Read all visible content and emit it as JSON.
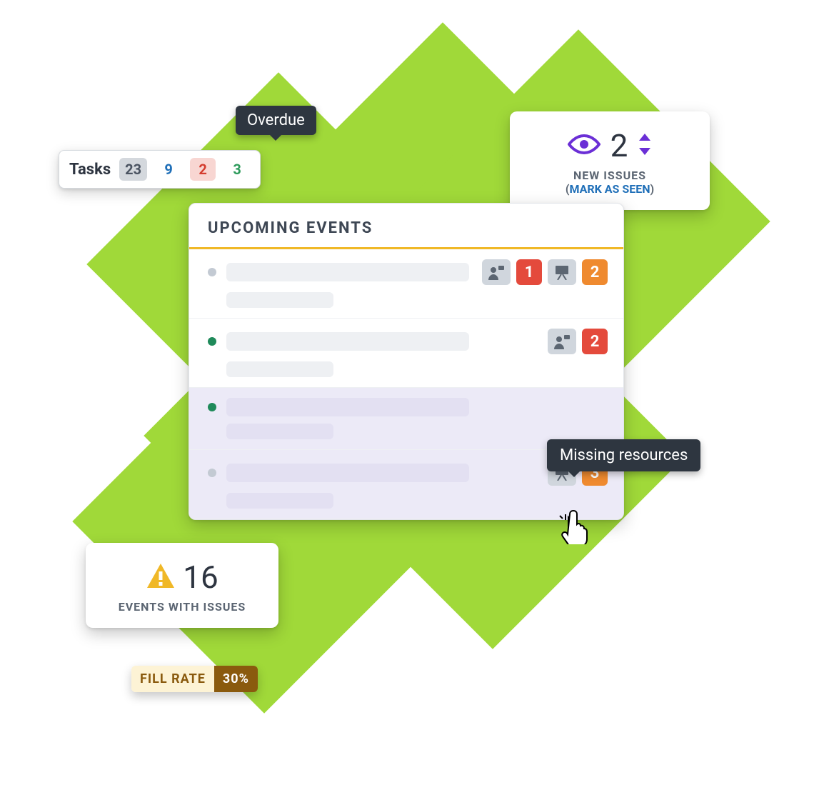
{
  "tasks": {
    "label": "Tasks",
    "counts": {
      "gray": "23",
      "blue": "9",
      "red": "2",
      "green": "3"
    }
  },
  "tooltips": {
    "overdue": "Overdue",
    "missing_resources": "Missing resources"
  },
  "new_issues": {
    "count": "2",
    "label": "NEW ISSUES",
    "mark_seen": "MARK AS SEEN"
  },
  "upcoming": {
    "title": "UPCOMING EVENTS",
    "rows": [
      {
        "dot": "gray",
        "person_badge": "1",
        "resource_badge": "2"
      },
      {
        "dot": "green2",
        "person_badge": "2",
        "resource_badge": null
      },
      {
        "dot": "green2",
        "person_badge": null,
        "resource_badge": null,
        "selected": true
      },
      {
        "dot": "gray",
        "person_badge": null,
        "resource_badge": "3",
        "selected": true
      }
    ]
  },
  "events_issues": {
    "count": "16",
    "label": "EVENTS WITH ISSUES"
  },
  "fill_rate": {
    "label": "FILL RATE",
    "value": "30%"
  },
  "colors": {
    "accent_green": "#a0d939",
    "purple": "#6b2fd6",
    "orange": "#ef8a2f",
    "red": "#e44a3c",
    "yellow_bar": "#f0b827"
  }
}
